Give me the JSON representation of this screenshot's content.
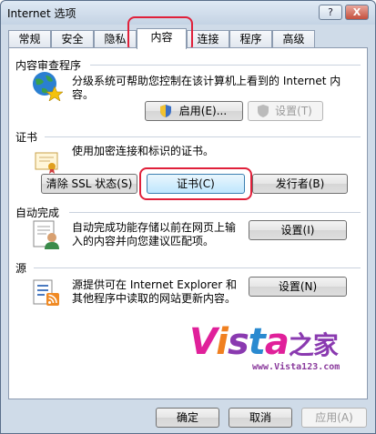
{
  "window": {
    "title": "Internet 选项"
  },
  "titlebar_buttons": {
    "help": "?",
    "close": "X"
  },
  "tabs": [
    {
      "label": "常规"
    },
    {
      "label": "安全"
    },
    {
      "label": "隐私"
    },
    {
      "label": "内容"
    },
    {
      "label": "连接"
    },
    {
      "label": "程序"
    },
    {
      "label": "高级"
    }
  ],
  "content_advisor": {
    "title": "内容审查程序",
    "description_line1": "分级系统可帮助您控制在该计算机上看到的 Internet 内",
    "description_line2": "容。",
    "enable_button": "启用(E)...",
    "settings_button": "设置(T)"
  },
  "certificates": {
    "title": "证书",
    "description": "使用加密连接和标识的证书。",
    "clear_ssl_button": "清除 SSL 状态(S)",
    "certificates_button": "证书(C)",
    "publishers_button": "发行者(B)"
  },
  "autocomplete": {
    "title": "自动完成",
    "description_line1": "自动完成功能存储以前在网页上输",
    "description_line2": "入的内容并向您建议匹配项。",
    "settings_button": "设置(I)"
  },
  "feeds": {
    "title": "源",
    "description_line1": "源提供可在 Internet Explorer 和",
    "description_line2": "其他程序中读取的网站更新内容。",
    "settings_button": "设置(N)"
  },
  "watermark": {
    "brand_v": "V",
    "brand_i": "i",
    "brand_s": "s",
    "brand_t": "t",
    "brand_a": "a",
    "brand_cn": "之家",
    "url": "www.Vista123.com"
  },
  "footer": {
    "ok_button": "确定",
    "cancel_button": "取消",
    "apply_button": "应用(A)"
  }
}
